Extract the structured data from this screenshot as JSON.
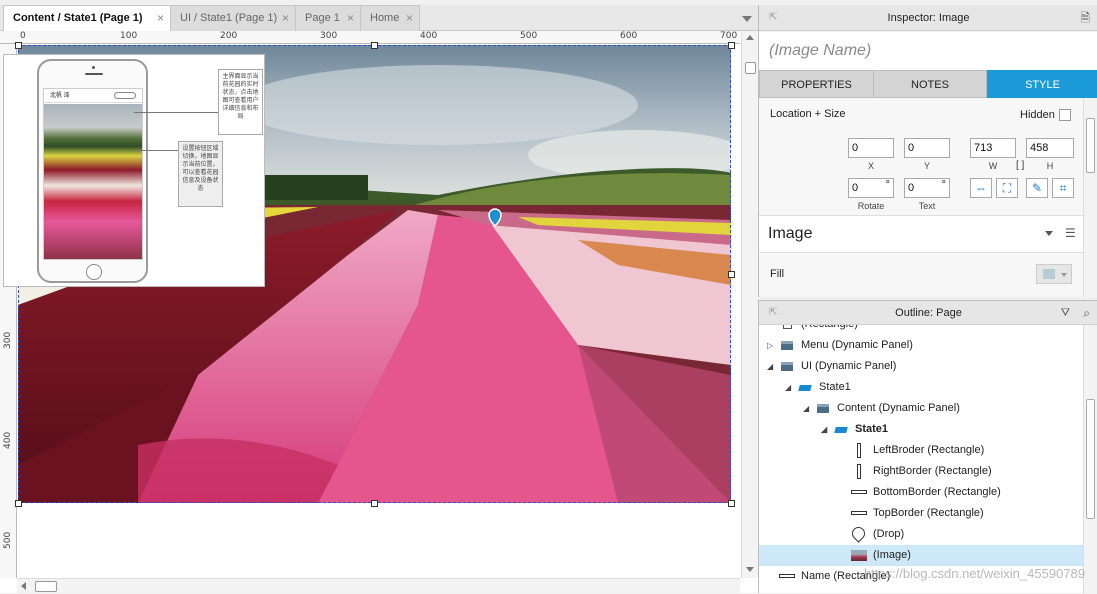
{
  "tabs": [
    {
      "label": "Content / State1 (Page 1)",
      "active": true
    },
    {
      "label": "UI / State1 (Page 1)",
      "active": false
    },
    {
      "label": "Page 1",
      "active": false
    },
    {
      "label": "Home",
      "active": false
    }
  ],
  "tab_close_glyph": "×",
  "ruler": {
    "top_labels": [
      "0",
      "100",
      "200",
      "300",
      "400",
      "500",
      "600",
      "700"
    ],
    "left_labels": [
      "300",
      "400",
      "500"
    ]
  },
  "mockup": {
    "status_text": "北帆 泽",
    "note1": "主界面显示当前花园的实时状态，点击地图可查看用户详细信息和布局",
    "note2": "设置按钮区域切换，地图显示当前位置，可以查看花园信息及设备状态"
  },
  "inspector": {
    "title": "Inspector: Image",
    "image_name_placeholder": "(Image Name)",
    "tabs": [
      "PROPERTIES",
      "NOTES",
      "STYLE"
    ],
    "active_tab": "STYLE",
    "location_size_label": "Location + Size",
    "hidden_label": "Hidden",
    "x_value": "0",
    "y_value": "0",
    "w_value": "713",
    "h_value": "458",
    "x_label": "X",
    "y_label": "Y",
    "w_label": "W",
    "h_label": "H",
    "rotate_value": "0",
    "text_value": "0",
    "degree_symbol": "°",
    "rotate_label": "Rotate",
    "text_label": "Text",
    "image_section_title": "Image",
    "fill_label": "Fill",
    "accent_color": "#1a9ad6"
  },
  "outline": {
    "title": "Outline: Page",
    "items": [
      {
        "label": "(Rectangle)",
        "level": 1,
        "icon": "rectangle-icon",
        "expander": ""
      },
      {
        "label": "Menu (Dynamic Panel)",
        "level": 0,
        "icon": "dynamic-panel-icon",
        "expander": "▷"
      },
      {
        "label": "UI (Dynamic Panel)",
        "level": 0,
        "icon": "dynamic-panel-icon",
        "expander": "◢"
      },
      {
        "label": "State1",
        "level": 1,
        "icon": "state-icon",
        "expander": "◢"
      },
      {
        "label": "Content (Dynamic Panel)",
        "level": 2,
        "icon": "dynamic-panel-icon",
        "expander": "◢"
      },
      {
        "label": "State1",
        "level": 3,
        "icon": "state-icon",
        "expander": "◢",
        "bold": true
      },
      {
        "label": "LeftBroder (Rectangle)",
        "level": 4,
        "icon": "vertical-rect-icon",
        "expander": ""
      },
      {
        "label": "RightBorder (Rectangle)",
        "level": 4,
        "icon": "vertical-rect-icon",
        "expander": ""
      },
      {
        "label": "BottomBorder (Rectangle)",
        "level": 4,
        "icon": "horizontal-rect-icon",
        "expander": ""
      },
      {
        "label": "TopBorder (Rectangle)",
        "level": 4,
        "icon": "horizontal-rect-icon",
        "expander": ""
      },
      {
        "label": "(Drop)",
        "level": 4,
        "icon": "drop-icon",
        "expander": ""
      },
      {
        "label": "(Image)",
        "level": 4,
        "icon": "image-icon",
        "expander": "",
        "selected": true
      },
      {
        "label": "Name (Rectangle)",
        "level": 0,
        "icon": "horizontal-rect-icon",
        "expander": ""
      }
    ]
  },
  "watermark": "https://blog.csdn.net/weixin_45590789"
}
